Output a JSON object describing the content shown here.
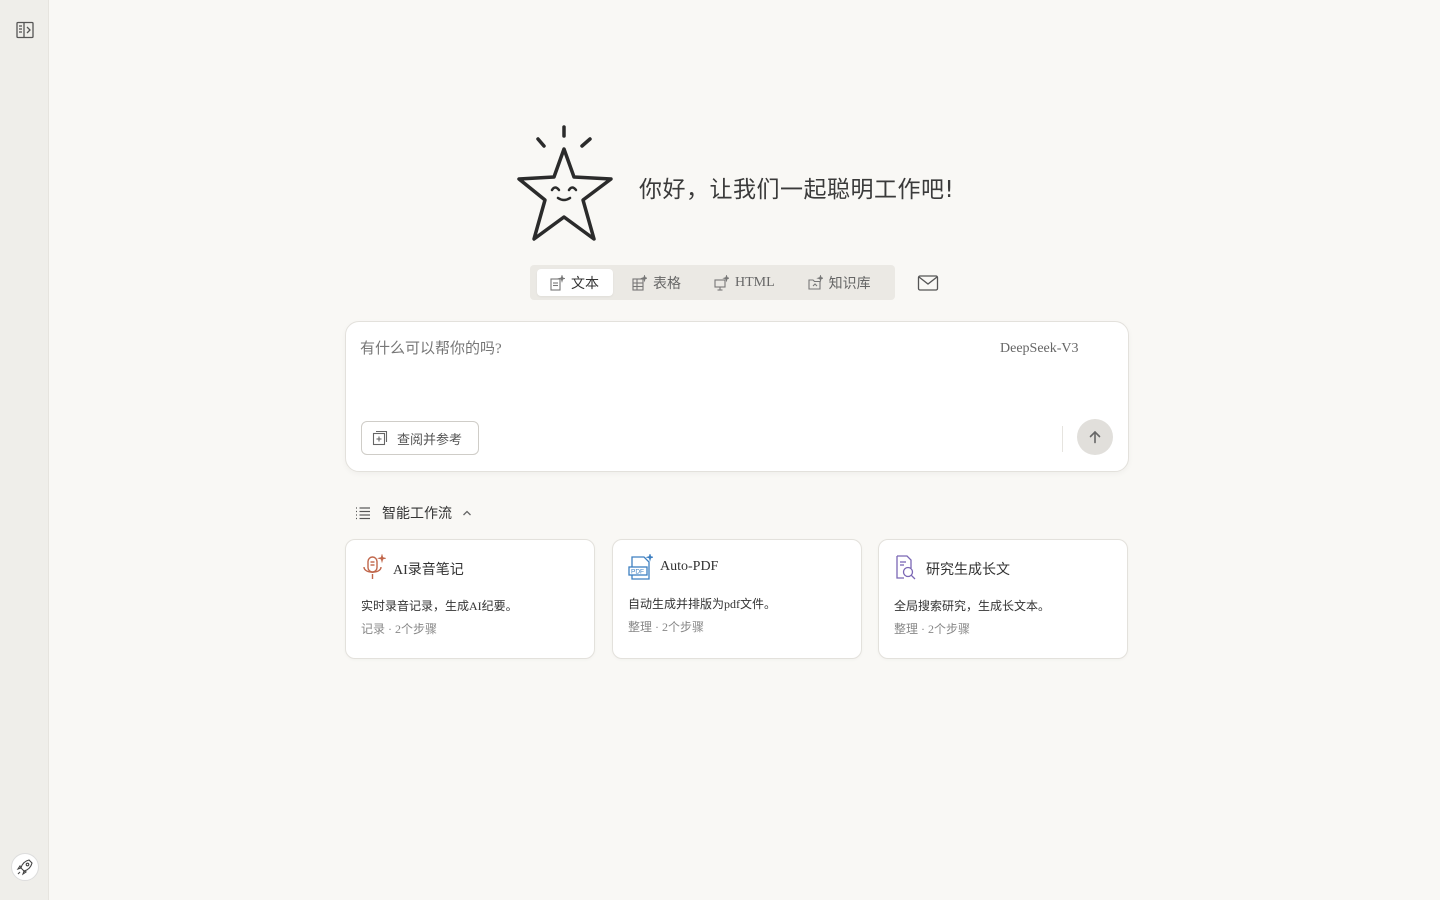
{
  "greeting": "你好，让我们一起聪明工作吧!",
  "mode_tabs": [
    {
      "label": "文本",
      "icon": "doc-sparkle-icon",
      "active": true
    },
    {
      "label": "表格",
      "icon": "table-sparkle-icon",
      "active": false
    },
    {
      "label": "HTML",
      "icon": "code-sparkle-icon",
      "active": false
    },
    {
      "label": "知识库",
      "icon": "folder-sparkle-icon",
      "active": false
    }
  ],
  "composer": {
    "placeholder": "有什么可以帮你的吗?",
    "value": "",
    "model": "DeepSeek-V3",
    "reference_label": "查阅并参考"
  },
  "workflow": {
    "title": "智能工作流",
    "cards": [
      {
        "title": "AI录音笔记",
        "desc": "实时录音记录，生成AI纪要。",
        "meta": "记录 · 2个步骤",
        "icon": "microphone-icon",
        "icon_color": "#c0664a"
      },
      {
        "title": "Auto-PDF",
        "desc": "自动生成并排版为pdf文件。",
        "meta": "整理 · 2个步骤",
        "icon": "pdf-file-icon",
        "icon_color": "#3d7fc1"
      },
      {
        "title": "研究生成长文",
        "desc": "全局搜索研究，生成长文本。",
        "meta": "整理 · 2个步骤",
        "icon": "search-document-icon",
        "icon_color": "#7b67b5"
      }
    ]
  },
  "colors": {
    "background": "#f9f8f5",
    "sidebar": "#efeeea",
    "accent_mic": "#c0664a",
    "accent_pdf": "#3d7fc1",
    "accent_research": "#7b67b5"
  }
}
